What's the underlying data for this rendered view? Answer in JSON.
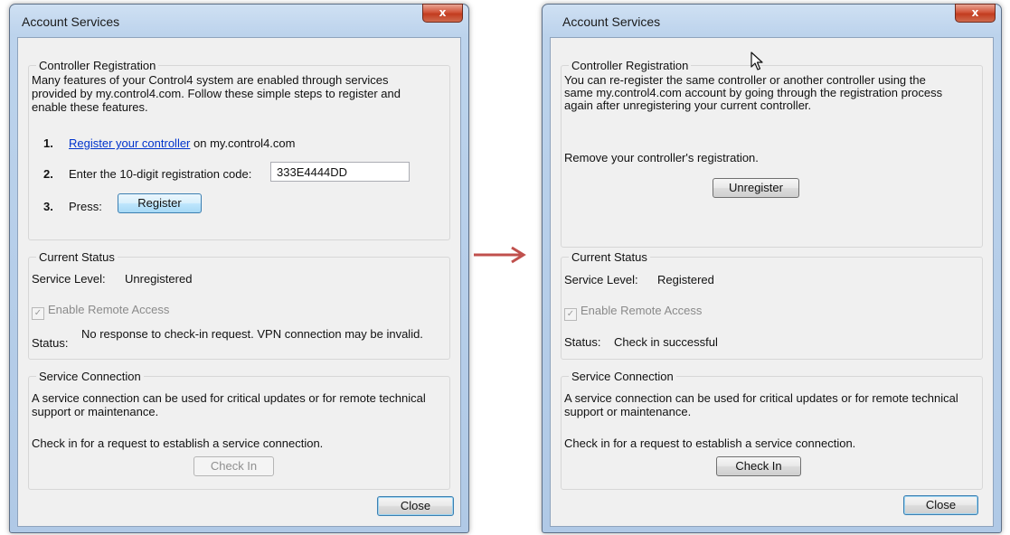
{
  "left": {
    "title": "Account Services",
    "close_x": "x",
    "reg": {
      "legend": "Controller Registration",
      "intro": "Many features of your Control4 system are enabled through services provided by my.control4.com. Follow these simple steps to register and enable these features.",
      "step1_num": "1.",
      "step1_link": "Register your controller",
      "step1_rest": " on my.control4.com",
      "step2_num": "2.",
      "step2_text": "Enter the 10-digit registration code:",
      "step2_code": "333E4444DD",
      "step3_num": "3.",
      "step3_text": "Press:",
      "register_button": "Register"
    },
    "status": {
      "legend": "Current Status",
      "service_level_label": "Service Level:",
      "service_level_value": "Unregistered",
      "enable_remote_access": "Enable Remote Access",
      "status_label": "Status:",
      "status_value": "No response to check-in request.  VPN connection may be invalid."
    },
    "service": {
      "legend": "Service Connection",
      "desc": "A service connection can be used for critical updates or for remote technical support or maintenance.",
      "check_text": "Check in for a request to establish a service connection.",
      "check_in_button": "Check In"
    },
    "close_button": "Close"
  },
  "right": {
    "title": "Account Services",
    "close_x": "x",
    "reg": {
      "legend": "Controller Registration",
      "intro": "You can re-register the same controller or another controller using the same my.control4.com account by going through the registration process again after unregistering your current controller.",
      "remove_text": "Remove your controller's registration.",
      "unregister_button": "Unregister"
    },
    "status": {
      "legend": "Current Status",
      "service_level_label": "Service Level:",
      "service_level_value": "Registered",
      "enable_remote_access": "Enable Remote Access",
      "status_label": "Status:",
      "status_value": "Check in successful"
    },
    "service": {
      "legend": "Service Connection",
      "desc": "A service connection can be used for critical updates or for remote technical support or maintenance.",
      "check_text": "Check in for a request to establish a service connection.",
      "check_in_button": "Check In"
    },
    "close_button": "Close"
  },
  "colors": {
    "arrow": "#c0504d",
    "link": "#0033cc",
    "close_x": "#c23c1f"
  },
  "icons": {
    "arrow": "right-arrow-icon",
    "cursor": "mouse-cursor-icon",
    "check": "checkmark-icon"
  }
}
